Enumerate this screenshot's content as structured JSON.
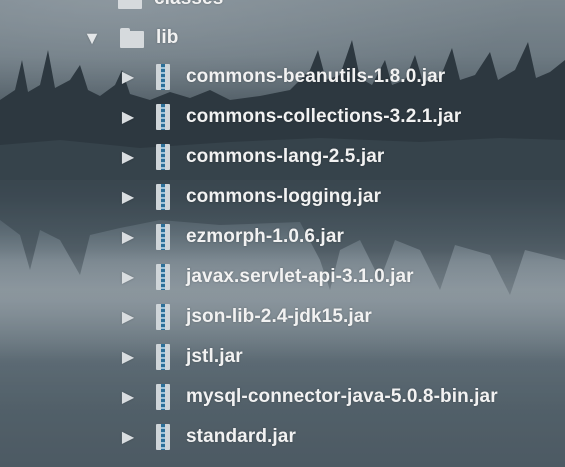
{
  "tree": {
    "top_partial": {
      "label": "classes"
    },
    "lib_folder": {
      "label": "lib",
      "expanded": true
    },
    "items": [
      {
        "label": "commons-beanutils-1.8.0.jar",
        "icon": "jar-icon"
      },
      {
        "label": "commons-collections-3.2.1.jar",
        "icon": "jar-icon"
      },
      {
        "label": "commons-lang-2.5.jar",
        "icon": "jar-icon"
      },
      {
        "label": "commons-logging.jar",
        "icon": "jar-icon"
      },
      {
        "label": "ezmorph-1.0.6.jar",
        "icon": "jar-icon"
      },
      {
        "label": "javax.servlet-api-3.1.0.jar",
        "icon": "jar-icon"
      },
      {
        "label": "json-lib-2.4-jdk15.jar",
        "icon": "jar-icon"
      },
      {
        "label": "jstl.jar",
        "icon": "jar-icon"
      },
      {
        "label": "mysql-connector-java-5.0.8-bin.jar",
        "icon": "jar-icon"
      },
      {
        "label": "standard.jar",
        "icon": "jar-icon"
      }
    ]
  },
  "colors": {
    "text": "#f2f2f2",
    "jar_stripe": "#2b6f98",
    "folder": "#d6dadd"
  }
}
